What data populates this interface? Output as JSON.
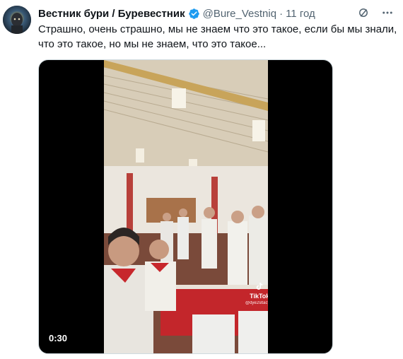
{
  "tweet": {
    "display_name": "Вестник бури / Буревестник",
    "handle": "@Bure_Vestniq",
    "separator": "·",
    "time": "11 год",
    "text_lines": [
      "Страшно, очень страшно, мы не знаем что это такое, если бы мы знали,",
      "что это такое, но мы не знаем, что это такое..."
    ]
  },
  "media": {
    "duration": "0:30",
    "watermark_name": "TikTok",
    "watermark_user": "@dye2sltacylni"
  },
  "icons": {
    "verified": "verified-badge-icon",
    "grok": "grok-icon",
    "more": "more-options-icon"
  },
  "colors": {
    "verified": "#1d9bf0",
    "text": "#0f1419",
    "secondary": "#536471"
  }
}
